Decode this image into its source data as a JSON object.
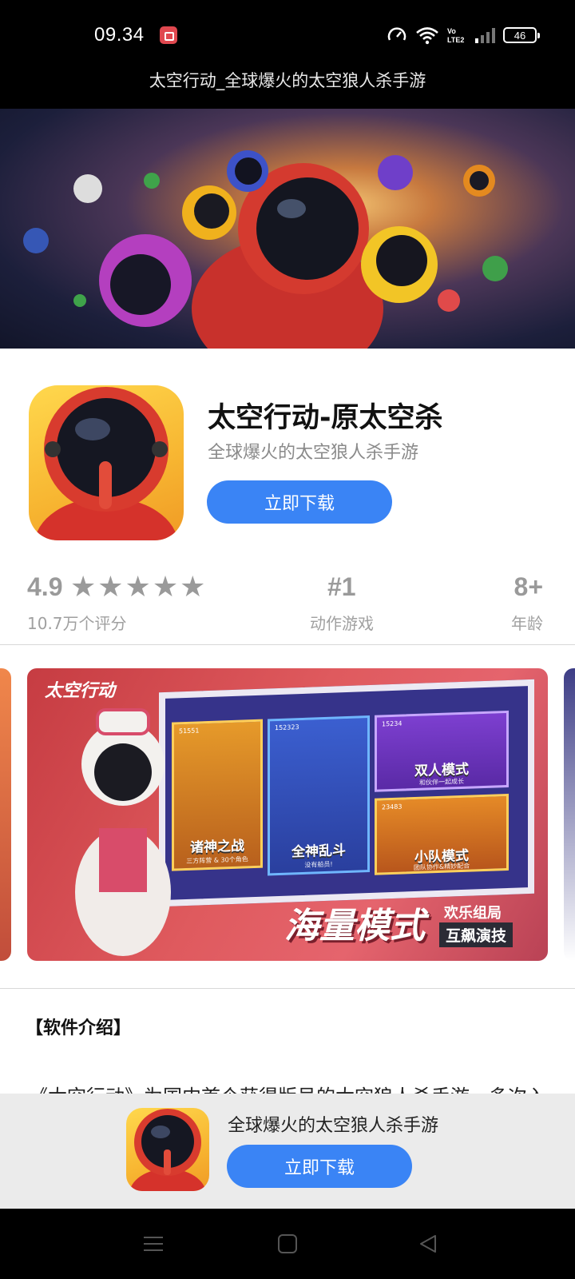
{
  "status_bar": {
    "time": "09.34",
    "battery": "46",
    "icons": [
      "screen-record-icon",
      "speed-icon",
      "wifi-icon",
      "volte-icon",
      "signal-icon",
      "battery-icon"
    ]
  },
  "page": {
    "title": "太空行动_全球爆火的太空狼人杀手游"
  },
  "app": {
    "name": "太空行动-原太空杀",
    "subtitle": "全球爆火的太空狼人杀手游",
    "download_label": "立即下载",
    "rating": "4.9",
    "stars": "★★★★★",
    "rating_count": "10.7万个评分",
    "rank": "#1",
    "rank_category": "动作游戏",
    "age": "8+",
    "age_label": "年龄"
  },
  "screenshot": {
    "logo": "太空行动",
    "modes": [
      {
        "label": "诸神之战",
        "sub": "三方阵营 & 30个角色",
        "count": "51551"
      },
      {
        "label": "全神乱斗",
        "sub": "没有船员!",
        "count": "152323"
      },
      {
        "label": "双人模式",
        "sub": "和伙伴一起成长",
        "count": "15234"
      },
      {
        "label": "小队模式",
        "sub": "团队协作&精妙配合",
        "count": "23483"
      }
    ],
    "headline": "海量模式",
    "tag1": "欢乐组局",
    "tag2": "互飙演技"
  },
  "intro": {
    "title": "【软件介绍】",
    "text": "《太空行动》为国内首个获得版号的太空狼人杀手游，多次入"
  },
  "banner": {
    "text": "全球爆火的太空狼人杀手游",
    "download_label": "立即下载"
  },
  "colors": {
    "accent": "#3a84f5",
    "status_bg": "#000000",
    "banner_bg": "#ebebeb"
  }
}
